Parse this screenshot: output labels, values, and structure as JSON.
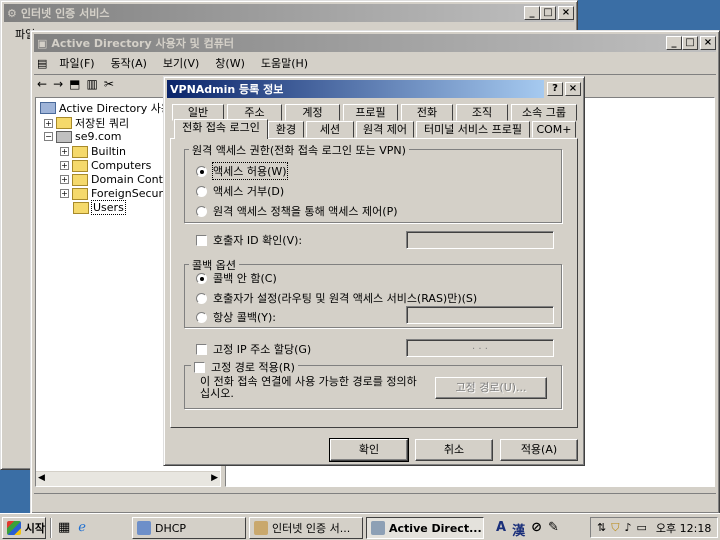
{
  "back_window": {
    "title": "인터넷 인증 서비스",
    "menu_first": "파일"
  },
  "ad_window": {
    "title": "Active Directory 사용자 및 컴퓨터",
    "menu": [
      "파일(F)",
      "동작(A)",
      "보기(V)",
      "창(W)",
      "도움말(H)"
    ],
    "tree": {
      "root": "Active Directory 사용자",
      "saved_queries": "저장된 쿼리",
      "domain": "se9.com",
      "children": [
        "Builtin",
        "Computers",
        "Domain Contro",
        "ForeignSecurit",
        "Users"
      ]
    }
  },
  "dialog": {
    "title": "VPNAdmin 등록 정보",
    "tabs_row1": [
      "일반",
      "주소",
      "계정",
      "프로필",
      "전화",
      "조직",
      "소속 그룹"
    ],
    "tabs_row2": [
      "전화 접속 로그인",
      "환경",
      "세션",
      "원격 제어",
      "터미널 서비스 프로필",
      "COM+"
    ],
    "active_tab": "전화 접속 로그인",
    "remote_access_group": "원격 액세스 권한(전화 접속 로그인 또는 VPN)",
    "remote_access_options": [
      "액세스 허용(W)",
      "액세스 거부(D)",
      "원격 액세스 정책을 통해 액세스 제어(P)"
    ],
    "remote_access_selected": 0,
    "verify_caller_id": "호출자 ID 확인(V):",
    "callback_group": "콜백 옵션",
    "callback_options": [
      "콜백 안 함(C)",
      "호출자가 설정(라우팅 및 원격 액세스 서비스(RAS)만)(S)",
      "항상 콜백(Y):"
    ],
    "callback_selected": 0,
    "static_ip": "고정 IP 주소 할당(G)",
    "ip_placeholder": ".      .      .",
    "static_routes": "고정 경로 적용(R)",
    "static_routes_desc": "이 전화 접속 연결에 사용 가능한 경로를 정의하십시오.",
    "static_routes_button": "고정 경로(U)...",
    "ok": "확인",
    "cancel": "취소",
    "apply": "적용(A)"
  },
  "taskbar": {
    "start": "시작",
    "tasks": [
      "DHCP",
      "인터넷 인증 서...",
      "Active Direct..."
    ],
    "active_task": 2,
    "ime": [
      "A",
      "漢"
    ],
    "time": "오후 12:18"
  },
  "colors": {
    "desktop": "#3a6ea5",
    "active_title": "#0a246a",
    "inactive_title": "#808080",
    "face": "#d4d0c8"
  }
}
